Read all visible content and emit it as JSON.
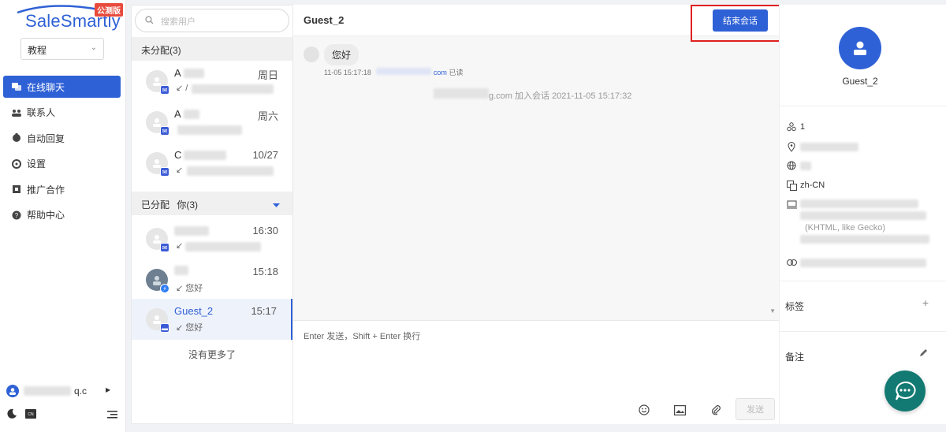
{
  "brand": {
    "logo_text": "SaleSmartly",
    "badge": "公测版",
    "primary_color": "#2f61d6",
    "alert_color": "#e84b3c"
  },
  "workspace": {
    "selected": "教程"
  },
  "nav": {
    "items": [
      {
        "label": "在线聊天",
        "icon": "chat-icon",
        "active": true
      },
      {
        "label": "联系人",
        "icon": "contacts-icon",
        "active": false
      },
      {
        "label": "自动回复",
        "icon": "robot-icon",
        "active": false
      },
      {
        "label": "设置",
        "icon": "gear-icon",
        "active": false
      },
      {
        "label": "推广合作",
        "icon": "promo-icon",
        "active": false
      },
      {
        "label": "帮助中心",
        "icon": "help-icon",
        "active": false
      }
    ]
  },
  "account": {
    "email_visible": "q.c"
  },
  "search": {
    "placeholder": "搜索用户"
  },
  "groups": {
    "unassigned": {
      "label": "未分配(3)"
    },
    "assigned": {
      "label": "已分配",
      "filter": "你(3)"
    }
  },
  "conversations": [
    {
      "name": "A",
      "time": "周日",
      "preview": "↙ /",
      "channel": "email"
    },
    {
      "name": "A",
      "time": "周六",
      "preview": "",
      "channel": "email"
    },
    {
      "name": "C",
      "time": "10/27",
      "preview": "↙",
      "channel": "email"
    },
    {
      "name": "",
      "time": "16:30",
      "preview": "↙",
      "channel": "email"
    },
    {
      "name": "",
      "time": "15:18",
      "preview": "↙ 您好",
      "channel": "messenger"
    },
    {
      "name": "Guest_2",
      "time": "15:17",
      "preview": "↙ 您好",
      "channel": "web",
      "selected": true
    }
  ],
  "list_footer": "没有更多了",
  "chat": {
    "title": "Guest_2",
    "end_button": "结束会话",
    "messages": [
      {
        "text": "您好",
        "meta_time": "11-05 15:17:18",
        "meta_link": "com",
        "meta_status": "已读"
      }
    ],
    "system_note": "g.com 加入会话 2021-11-05 15:17:32",
    "composer_placeholder": "Enter 发送，Shift + Enter 换行",
    "send_label": "发送"
  },
  "profile": {
    "name": "Guest_2",
    "visits": "1",
    "language": "zh-CN",
    "ua_line2": "(KHTML, like Gecko)",
    "tags_label": "标签",
    "notes_label": "备注"
  }
}
